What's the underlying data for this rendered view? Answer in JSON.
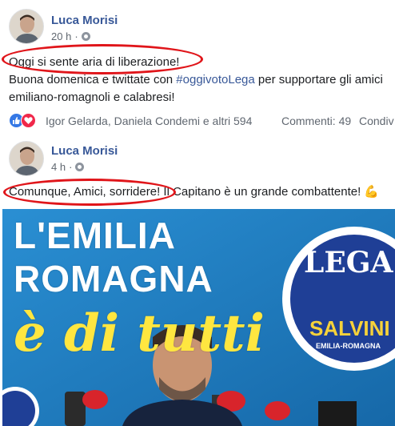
{
  "posts": [
    {
      "author": "Luca Morisi",
      "time": "20 h",
      "text_lines": [
        "Oggi si sente aria di liberazione!"
      ],
      "line2_before": "Buona domenica e twittate con ",
      "line2_hashtag": "#oggivotoLega",
      "line2_after": " per supportare gli amici",
      "line3": "emiliano-romagnoli e calabresi!",
      "reactions": {
        "names": "Igor Gelarda, Daniela Condemi e altri 594",
        "comments": "Commenti: 49",
        "shares": "Condiv"
      }
    },
    {
      "author": "Luca Morisi",
      "time": "4 h",
      "text": "Comunque, Amici, sorridere! Il Capitano è un grande combattente! 💪"
    }
  ],
  "banner": {
    "line1": "L'EMILIA",
    "line2": "ROMAGNA",
    "line3": "è di tutti",
    "logo_text": "LEGA",
    "logo_name": "SALVINI",
    "logo_region": "EMILIA-ROMAGNA"
  },
  "colors": {
    "link": "#385898",
    "highlight_oval": "#e0151a",
    "banner_blue": "#1c7fc4",
    "logo_blue": "#1f3f96"
  }
}
